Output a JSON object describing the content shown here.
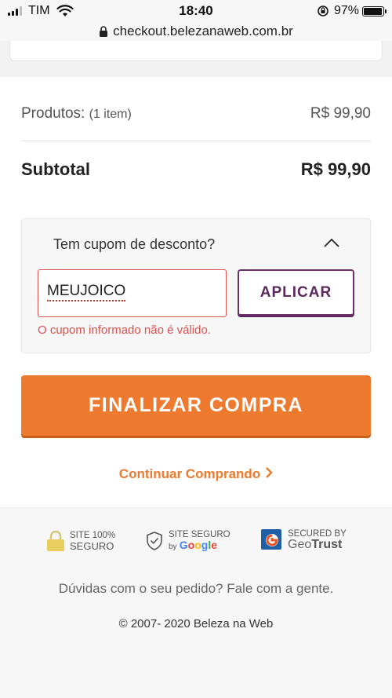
{
  "status_bar": {
    "carrier": "TIM",
    "time": "18:40",
    "battery": "97%",
    "battery_level": 0.97
  },
  "url_bar": {
    "url": "checkout.belezanaweb.com.br"
  },
  "summary": {
    "products_label": "Produtos:",
    "products_count": "(1 item)",
    "products_value": "R$ 99,90",
    "subtotal_label": "Subtotal",
    "subtotal_value": "R$ 99,90"
  },
  "coupon": {
    "question": "Tem cupom de desconto?",
    "input_value": "MEUJOICO",
    "apply_label": "APLICAR",
    "error": "O cupom informado não é válido."
  },
  "actions": {
    "finalize_label": "FINALIZAR COMPRA",
    "continue_label": "Continuar Comprando"
  },
  "footer": {
    "seal1_line1": "SITE 100%",
    "seal1_line2": "SEGURO",
    "seal2_line1": "SITE SEGURO",
    "seal2_by": "by",
    "seal2_google": "Google",
    "seal3_line1": "SECURED BY",
    "seal3_geo": "Geo",
    "seal3_trust": "Trust",
    "help": "Dúvidas com o seu pedido? Fale com a gente.",
    "copyright": "© 2007- 2020 Beleza na Web"
  },
  "colors": {
    "accent_orange": "#ed7a2e",
    "accent_purple": "#6b2f6b",
    "error_red": "#d9534f"
  },
  "icons": [
    "signal-icon",
    "wifi-icon",
    "orientation-lock-icon",
    "battery-icon",
    "lock-icon",
    "chevron-up-icon",
    "chevron-right-icon",
    "padlock-seal-icon",
    "shield-check-icon",
    "geotrust-logo-icon"
  ]
}
